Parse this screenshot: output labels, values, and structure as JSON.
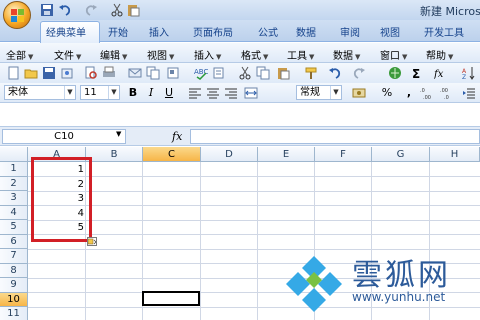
{
  "titlebar": {
    "title": "新建 Micros"
  },
  "ribbon_tabs": [
    {
      "label": "经典菜单"
    },
    {
      "label": "开始"
    },
    {
      "label": "插入"
    },
    {
      "label": "页面布局"
    },
    {
      "label": "公式"
    },
    {
      "label": "数据"
    },
    {
      "label": "审阅"
    },
    {
      "label": "视图"
    },
    {
      "label": "开发工具"
    }
  ],
  "menus": [
    {
      "label": "全部"
    },
    {
      "label": "文件"
    },
    {
      "label": "编辑"
    },
    {
      "label": "视图"
    },
    {
      "label": "插入"
    },
    {
      "label": "格式"
    },
    {
      "label": "工具"
    },
    {
      "label": "数据"
    },
    {
      "label": "窗口"
    },
    {
      "label": "帮助"
    }
  ],
  "format_bar": {
    "font": "宋体",
    "size": "11",
    "number_format": "常规",
    "bold": "B",
    "italic": "I",
    "underline": "U",
    "percent": "%",
    "comma": ","
  },
  "formula_bar": {
    "name_box": "C10",
    "fx": "fx",
    "formula": ""
  },
  "columns": [
    "A",
    "B",
    "C",
    "D",
    "E",
    "F",
    "G",
    "H"
  ],
  "selected_column": "C",
  "rows": [
    "1",
    "2",
    "3",
    "4",
    "5",
    "6",
    "7",
    "8",
    "9",
    "10",
    "11"
  ],
  "selected_row": "10",
  "cells_A": [
    "1",
    "2",
    "3",
    "4",
    "5"
  ],
  "colors": {
    "highlight_box": "#d21f26",
    "selected_header": "#f7b548",
    "accent": "#15428b"
  },
  "watermark": {
    "name": "雲狐网",
    "url": "www.yunhu.net"
  }
}
